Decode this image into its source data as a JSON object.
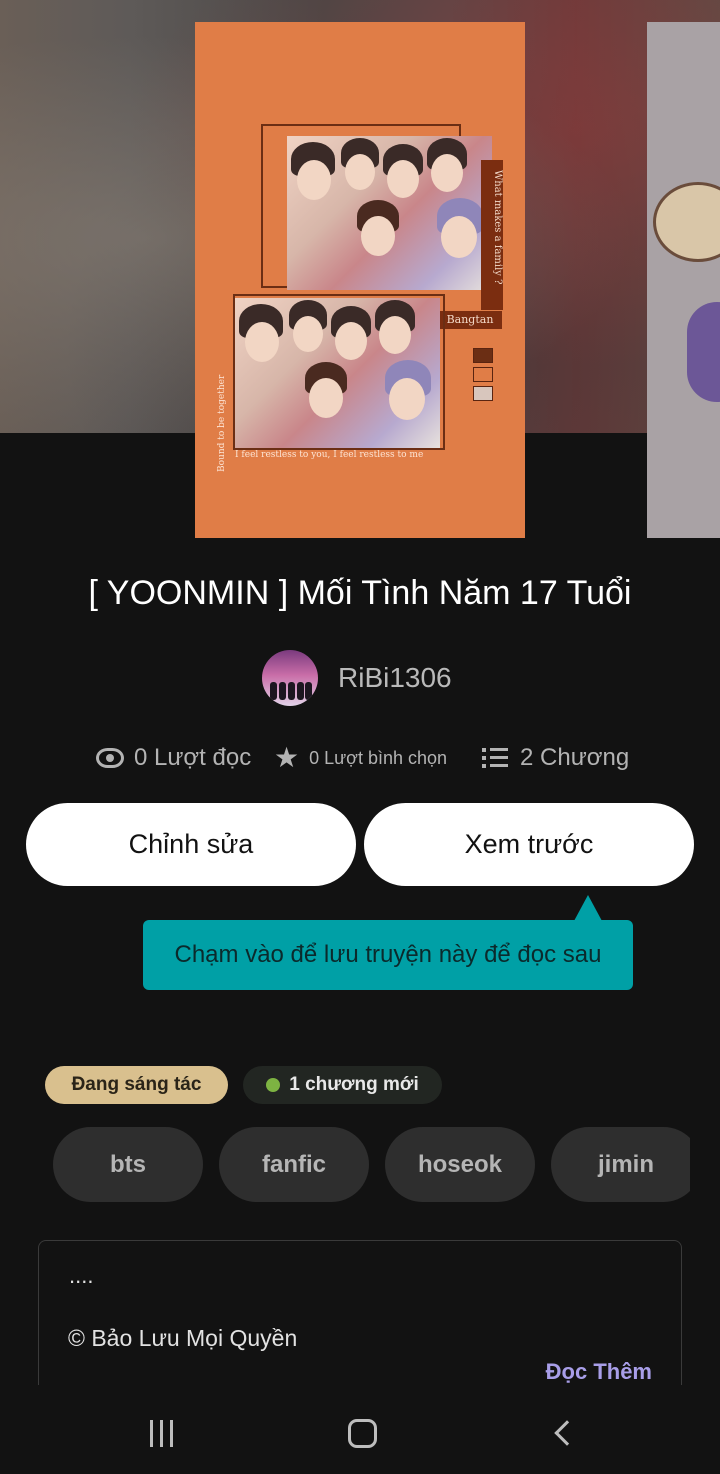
{
  "story": {
    "title": "[ YOONMIN ] Mối Tình Năm 17 Tuổi",
    "author": "RiBi1306"
  },
  "cover": {
    "side_text": "What makes a family ?",
    "tag_label": "Bangtan",
    "vertical_text": "Bound to be together",
    "caption": "I feel restless to you, I feel restless to me",
    "swatches": [
      "#6b2e14",
      "#e07d47",
      "#d8c6bd"
    ]
  },
  "stats": {
    "reads": "0 Lượt đọc",
    "votes": "0 Lượt bình chọn",
    "chapters": "2 Chương"
  },
  "actions": {
    "edit": "Chỉnh sửa",
    "preview": "Xem trước"
  },
  "tooltip": {
    "text": "Chạm vào để lưu truyện này để đọc sau"
  },
  "badges": {
    "status": "Đang sáng tác",
    "new_chapter": "1 chương mới"
  },
  "tags": [
    "bts",
    "fanfic",
    "hoseok",
    "jimin"
  ],
  "description": {
    "dots": "....",
    "copyright": "© Bảo Lưu Mọi Quyền",
    "read_more": "Đọc Thêm"
  },
  "colors": {
    "background": "#121212",
    "cover_orange": "#e07d47",
    "tooltip": "#00a0a6",
    "status_badge": "#d9c08e",
    "new_dot": "#7db342",
    "read_more": "#a89ee8"
  },
  "icons": {
    "reads": "eye-icon",
    "votes": "star-icon",
    "chapters": "list-icon",
    "nav": [
      "recent-apps-icon",
      "home-icon",
      "back-icon"
    ]
  }
}
